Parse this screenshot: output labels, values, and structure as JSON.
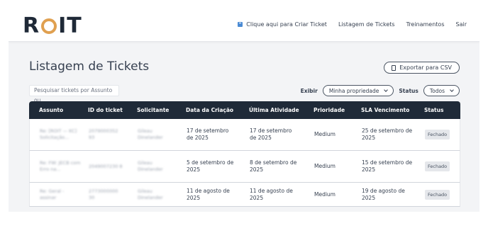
{
  "brand": {
    "logo_text_left": "R",
    "logo_text_right": "IT",
    "accent": "#e0a050"
  },
  "nav": {
    "create_icon": "ticket-plus-icon",
    "create_label": "Clique aqui para Criar Ticket",
    "list_label": "Listagem de Tickets",
    "training_label": "Treinamentos",
    "logout_label": "Sair"
  },
  "page": {
    "title": "Listagem de Tickets",
    "export_label": "Exportar para CSV",
    "export_icon": "file-icon"
  },
  "search": {
    "placeholder": "Pesquisar tickets por Assunto ou"
  },
  "filters": {
    "view_label": "Exibir",
    "view_value": "Minha propriedade",
    "status_label": "Status",
    "status_value": "Todos"
  },
  "table": {
    "header_bg": "#1f2a38",
    "columns": [
      "Assunto",
      "ID do ticket",
      "Solicitante",
      "Data da Criação",
      "Última Atividade",
      "Prioridade",
      "SLA Vencimento",
      "Status"
    ],
    "rows": [
      {
        "assunto": "Re: [ROIT — KC] Solicitação...",
        "id": "2079000352 93",
        "solicitante": "Gileau Dinelander",
        "criacao": "17 de setembro de 2025",
        "atividade": "17 de setembro de 2025",
        "prioridade": "Medium",
        "sla": "25 de setembro de 2025",
        "status": "Fechado"
      },
      {
        "assunto": "Re: FW: JECB com Erro na...",
        "id": "2049007230 8",
        "solicitante": "Gileau Dinelander",
        "criacao": "5 de setembro de 2025",
        "atividade": "8 de setembro de 2025",
        "prioridade": "Medium",
        "sla": "15 de setembro de 2025",
        "status": "Fechado"
      },
      {
        "assunto": "Re: Geral - assinar",
        "id": "2773000000 30",
        "solicitante": "Gileau Dinelander",
        "criacao": "11 de agosto de 2025",
        "atividade": "11 de agosto de 2025",
        "prioridade": "Medium",
        "sla": "19 de agosto de 2025",
        "status": "Fechado"
      }
    ]
  }
}
